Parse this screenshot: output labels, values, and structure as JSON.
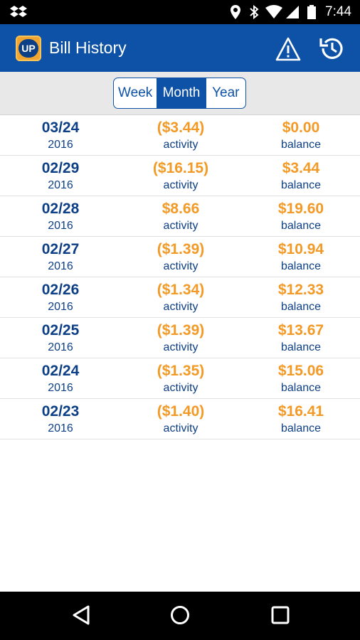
{
  "status_bar": {
    "time": "7:44",
    "icons": [
      "dropbox-icon",
      "location-icon",
      "bluetooth-icon",
      "wifi-icon",
      "battery-icon"
    ]
  },
  "app_bar": {
    "logo_text": "UP",
    "title": "Bill History",
    "actions": [
      "warning-icon",
      "refresh-icon"
    ]
  },
  "segmented": {
    "options": [
      "Week",
      "Month",
      "Year"
    ],
    "selected": "Month"
  },
  "rows": [
    {
      "date": "03/24",
      "year": "2016",
      "activity": "($3.44)",
      "activity_label": "activity",
      "balance": "$0.00",
      "balance_label": "balance"
    },
    {
      "date": "02/29",
      "year": "2016",
      "activity": "($16.15)",
      "activity_label": "activity",
      "balance": "$3.44",
      "balance_label": "balance"
    },
    {
      "date": "02/28",
      "year": "2016",
      "activity": "$8.66",
      "activity_label": "activity",
      "balance": "$19.60",
      "balance_label": "balance"
    },
    {
      "date": "02/27",
      "year": "2016",
      "activity": "($1.39)",
      "activity_label": "activity",
      "balance": "$10.94",
      "balance_label": "balance"
    },
    {
      "date": "02/26",
      "year": "2016",
      "activity": "($1.34)",
      "activity_label": "activity",
      "balance": "$12.33",
      "balance_label": "balance"
    },
    {
      "date": "02/25",
      "year": "2016",
      "activity": "($1.39)",
      "activity_label": "activity",
      "balance": "$13.67",
      "balance_label": "balance"
    },
    {
      "date": "02/24",
      "year": "2016",
      "activity": "($1.35)",
      "activity_label": "activity",
      "balance": "$15.06",
      "balance_label": "balance"
    },
    {
      "date": "02/23",
      "year": "2016",
      "activity": "($1.40)",
      "activity_label": "activity",
      "balance": "$16.41",
      "balance_label": "balance"
    }
  ],
  "nav_bar": {
    "buttons": [
      "back-icon",
      "home-icon",
      "recents-icon"
    ]
  },
  "colors": {
    "primary": "#0d52a6",
    "accent": "#f39a26",
    "text_blue": "#0d3f86"
  }
}
